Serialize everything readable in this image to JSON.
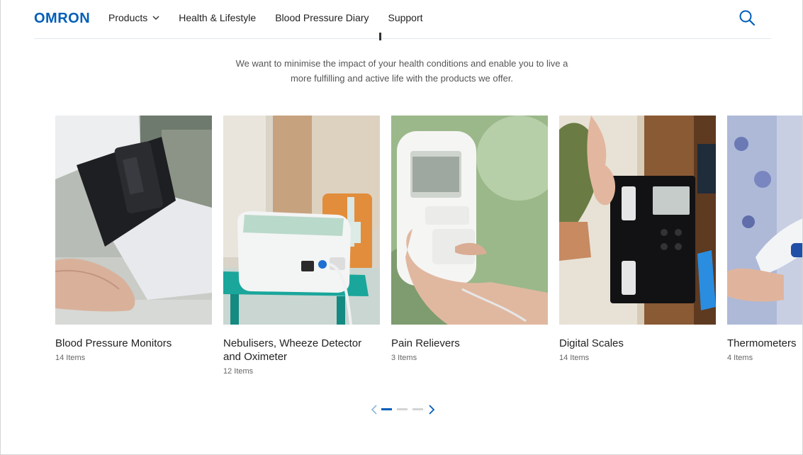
{
  "brand": {
    "logo_text": "OMRON",
    "accent": "#005EB8"
  },
  "nav": {
    "items": [
      {
        "label": "Products",
        "has_dropdown": true
      },
      {
        "label": "Health & Lifestyle"
      },
      {
        "label": "Blood Pressure Diary"
      },
      {
        "label": "Support"
      }
    ],
    "search_icon": "search-icon"
  },
  "intro": {
    "line1": "We want to minimise the impact of your health conditions and enable you to live a",
    "line2": "more fulfilling and active life with the products we offer."
  },
  "categories": [
    {
      "title": "Blood Pressure Monitors",
      "count": "14 Items"
    },
    {
      "title": "Nebulisers, Wheeze Detector and Oximeter",
      "count": "12 Items"
    },
    {
      "title": "Pain Relievers",
      "count": "3 Items"
    },
    {
      "title": "Digital Scales",
      "count": "14 Items"
    },
    {
      "title": "Thermometers",
      "count": "4 Items"
    }
  ],
  "pager": {
    "pages": 3,
    "active": 1,
    "prev_icon": "chevron-left-icon",
    "next_icon": "chevron-right-icon"
  }
}
